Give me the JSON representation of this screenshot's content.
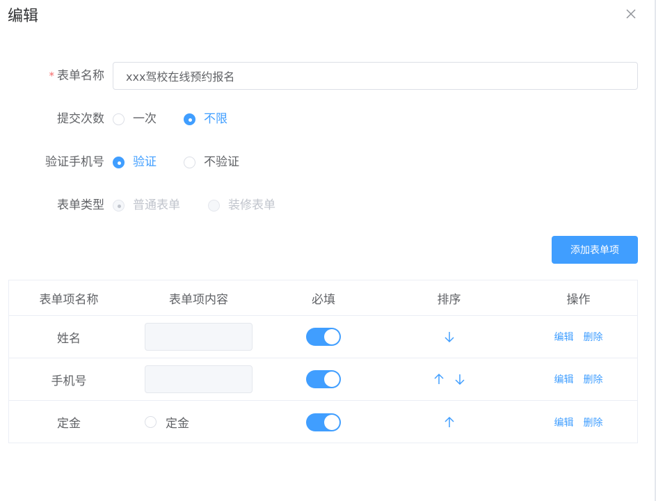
{
  "dialog": {
    "title": "编辑",
    "close_icon": "close-icon"
  },
  "form": {
    "name": {
      "label": "表单名称",
      "required_mark": "*",
      "value": "xxx驾校在线预约报名"
    },
    "submit_times": {
      "label": "提交次数",
      "options": [
        "一次",
        "不限"
      ],
      "selected": "不限"
    },
    "verify_phone": {
      "label": "验证手机号",
      "options": [
        "验证",
        "不验证"
      ],
      "selected": "验证"
    },
    "form_type": {
      "label": "表单类型",
      "options": [
        "普通表单",
        "装修表单"
      ],
      "selected": "普通表单",
      "disabled": true
    }
  },
  "add_button": {
    "label": "添加表单项"
  },
  "table": {
    "headers": [
      "表单项名称",
      "表单项内容",
      "必填",
      "排序",
      "操作"
    ],
    "rows": [
      {
        "name": "姓名",
        "content_type": "input",
        "required": true,
        "sort": [
          "down"
        ]
      },
      {
        "name": "手机号",
        "content_type": "input",
        "required": true,
        "sort": [
          "up",
          "down"
        ]
      },
      {
        "name": "定金",
        "content_type": "radio",
        "content_label": "定金",
        "required": true,
        "sort": [
          "up"
        ]
      }
    ],
    "actions": {
      "edit": "编辑",
      "delete": "删除"
    }
  },
  "colors": {
    "primary": "#409eff",
    "required": "#f56c6c",
    "text": "#606266",
    "title": "#303133",
    "disabled": "#c0c4cc"
  }
}
